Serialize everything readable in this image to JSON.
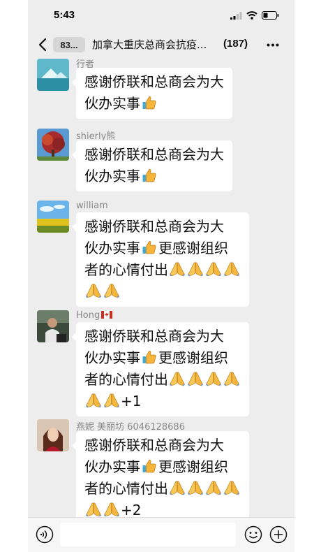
{
  "status_bar": {
    "time": "5:43"
  },
  "nav": {
    "back_badge": "83...",
    "title": "加拿大重庆总商会抗疫...",
    "member_count": "(187)"
  },
  "messages": [
    {
      "sender": "行者",
      "segments": [
        {
          "type": "text",
          "text": "感谢侨联和总商会为大"
        },
        {
          "type": "br"
        },
        {
          "type": "text",
          "text": "伙办实事"
        },
        {
          "type": "emoji",
          "name": "thumbs-up"
        }
      ]
    },
    {
      "sender": "shierly熊",
      "segments": [
        {
          "type": "text",
          "text": "感谢侨联和总商会为大"
        },
        {
          "type": "br"
        },
        {
          "type": "text",
          "text": "伙办实事"
        },
        {
          "type": "emoji",
          "name": "thumbs-up"
        }
      ]
    },
    {
      "sender": "william",
      "segments": [
        {
          "type": "text",
          "text": "感谢侨联和总商会为大"
        },
        {
          "type": "br"
        },
        {
          "type": "text",
          "text": "伙办实事"
        },
        {
          "type": "emoji",
          "name": "thumbs-up"
        },
        {
          "type": "text",
          "text": "更感谢组织"
        },
        {
          "type": "br"
        },
        {
          "type": "text",
          "text": "者的心情付出"
        },
        {
          "type": "emoji",
          "name": "praying-hands"
        },
        {
          "type": "emoji",
          "name": "praying-hands"
        },
        {
          "type": "emoji",
          "name": "praying-hands"
        },
        {
          "type": "emoji",
          "name": "praying-hands"
        },
        {
          "type": "br"
        },
        {
          "type": "emoji",
          "name": "praying-hands"
        },
        {
          "type": "emoji",
          "name": "praying-hands"
        }
      ]
    },
    {
      "sender": "Hong",
      "sender_flag": "canada-flag",
      "segments": [
        {
          "type": "text",
          "text": "感谢侨联和总商会为大"
        },
        {
          "type": "br"
        },
        {
          "type": "text",
          "text": "伙办实事"
        },
        {
          "type": "emoji",
          "name": "thumbs-up"
        },
        {
          "type": "text",
          "text": "更感谢组织"
        },
        {
          "type": "br"
        },
        {
          "type": "text",
          "text": "者的心情付出"
        },
        {
          "type": "emoji",
          "name": "praying-hands"
        },
        {
          "type": "emoji",
          "name": "praying-hands"
        },
        {
          "type": "emoji",
          "name": "praying-hands"
        },
        {
          "type": "emoji",
          "name": "praying-hands"
        },
        {
          "type": "br"
        },
        {
          "type": "emoji",
          "name": "praying-hands"
        },
        {
          "type": "emoji",
          "name": "praying-hands"
        },
        {
          "type": "text",
          "text": "+1"
        }
      ]
    },
    {
      "sender": "燕妮   美丽坊 6046128686",
      "segments": [
        {
          "type": "text",
          "text": "感谢侨联和总商会为大"
        },
        {
          "type": "br"
        },
        {
          "type": "text",
          "text": "伙办实事"
        },
        {
          "type": "emoji",
          "name": "thumbs-up"
        },
        {
          "type": "text",
          "text": "更感谢组织"
        },
        {
          "type": "br"
        },
        {
          "type": "text",
          "text": "者的心情付出"
        },
        {
          "type": "emoji",
          "name": "praying-hands"
        },
        {
          "type": "emoji",
          "name": "praying-hands"
        },
        {
          "type": "emoji",
          "name": "praying-hands"
        },
        {
          "type": "emoji",
          "name": "praying-hands"
        },
        {
          "type": "br"
        },
        {
          "type": "emoji",
          "name": "praying-hands"
        },
        {
          "type": "emoji",
          "name": "praying-hands"
        },
        {
          "type": "text",
          "text": "+2"
        }
      ]
    }
  ],
  "input_bar": {
    "placeholder": ""
  },
  "colors": {
    "background": "#ededed",
    "bubble": "#ffffff",
    "sender_text": "#888888"
  }
}
